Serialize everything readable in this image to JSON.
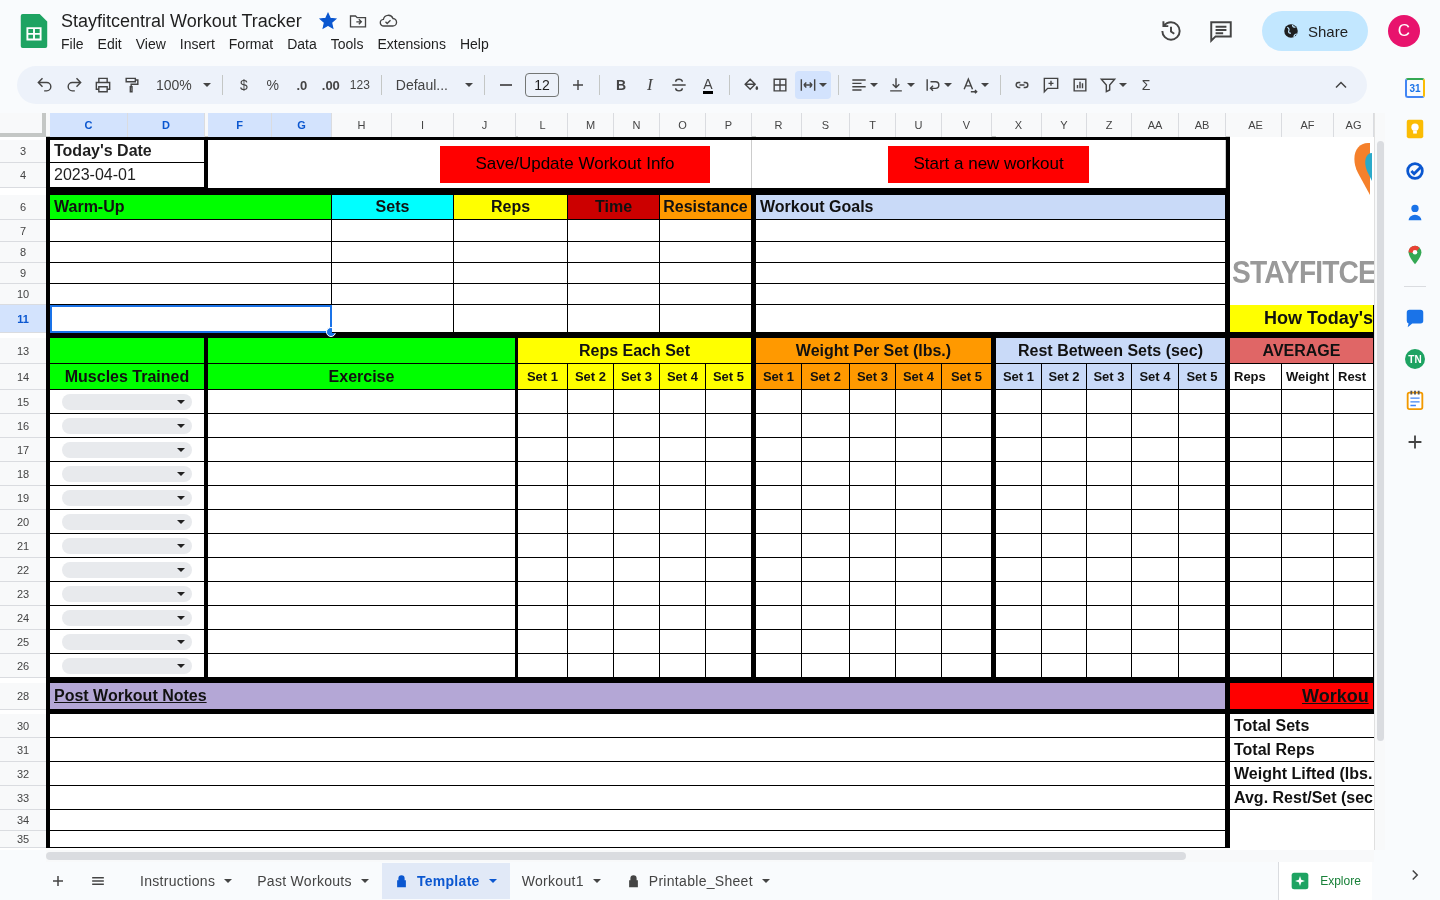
{
  "document": {
    "title": "Stayfitcentral Workout Tracker",
    "starred": true
  },
  "menu": [
    "File",
    "Edit",
    "View",
    "Insert",
    "Format",
    "Data",
    "Tools",
    "Extensions",
    "Help"
  ],
  "account": {
    "share": "Share",
    "avatar": "C"
  },
  "toolbar": [
    {
      "kind": "undo",
      "active": false
    },
    {
      "kind": "redo",
      "active": false
    },
    {
      "kind": "print",
      "active": false
    },
    {
      "kind": "paint",
      "active": false
    },
    {
      "kind": "zoom",
      "label": "100%",
      "active": false
    },
    {
      "kind": "sep"
    },
    {
      "kind": "text",
      "label": "$",
      "active": false
    },
    {
      "kind": "text",
      "label": "%",
      "active": false
    },
    {
      "kind": "decrease",
      "label": ".0",
      "active": false
    },
    {
      "kind": "increase",
      "label": ".00",
      "active": false
    },
    {
      "kind": "small",
      "label": "123",
      "active": false
    },
    {
      "kind": "sep"
    },
    {
      "kind": "font",
      "label": "Defaul...",
      "active": false
    },
    {
      "kind": "sep"
    },
    {
      "kind": "minus",
      "active": false
    },
    {
      "kind": "size",
      "label": "12"
    },
    {
      "kind": "plus",
      "active": false
    },
    {
      "kind": "sep"
    },
    {
      "kind": "bold",
      "label": "B",
      "active": false
    },
    {
      "kind": "italic",
      "label": "I",
      "active": false
    },
    {
      "kind": "strike",
      "active": false
    },
    {
      "kind": "textcolor",
      "label": "A",
      "active": false
    },
    {
      "kind": "sep"
    },
    {
      "kind": "fill",
      "active": false
    },
    {
      "kind": "borders",
      "active": false
    },
    {
      "kind": "merge",
      "active": true
    },
    {
      "kind": "sep"
    },
    {
      "kind": "align",
      "active": false
    },
    {
      "kind": "valign",
      "active": false
    },
    {
      "kind": "wrap",
      "active": false
    },
    {
      "kind": "rotate",
      "active": false
    },
    {
      "kind": "sep"
    },
    {
      "kind": "link",
      "active": false
    },
    {
      "kind": "comment",
      "active": false
    },
    {
      "kind": "chart",
      "active": false
    },
    {
      "kind": "filter",
      "active": false
    },
    {
      "kind": "text",
      "label": "Σ",
      "active": false
    }
  ],
  "columns": [
    {
      "label": "C",
      "selected": true
    },
    {
      "label": "D",
      "selected": true
    },
    {
      "label": "F",
      "selected": true
    },
    {
      "label": "G",
      "selected": true
    },
    {
      "label": "H",
      "selected": false
    },
    {
      "label": "I",
      "selected": false
    },
    {
      "label": "J",
      "selected": false
    },
    {
      "label": "L",
      "selected": false
    },
    {
      "label": "M",
      "selected": false
    },
    {
      "label": "N",
      "selected": false
    },
    {
      "label": "O",
      "selected": false
    },
    {
      "label": "P",
      "selected": false
    },
    {
      "label": "R",
      "selected": false
    },
    {
      "label": "S",
      "selected": false
    },
    {
      "label": "T",
      "selected": false
    },
    {
      "label": "U",
      "selected": false
    },
    {
      "label": "V",
      "selected": false
    },
    {
      "label": "X",
      "selected": false
    },
    {
      "label": "Y",
      "selected": false
    },
    {
      "label": "Z",
      "selected": false
    },
    {
      "label": "AA",
      "selected": false
    },
    {
      "label": "AB",
      "selected": false
    },
    {
      "label": "AE",
      "selected": false
    },
    {
      "label": "AF",
      "selected": false
    },
    {
      "label": "AG",
      "selected": false
    }
  ],
  "rows": [
    {
      "label": "3",
      "selected": false
    },
    {
      "label": "4",
      "selected": false
    },
    {
      "label": "6",
      "selected": false
    },
    {
      "label": "7",
      "selected": false
    },
    {
      "label": "8",
      "selected": false
    },
    {
      "label": "9",
      "selected": false
    },
    {
      "label": "10",
      "selected": false
    },
    {
      "label": "11",
      "selected": true
    },
    {
      "label": "13",
      "selected": false
    },
    {
      "label": "14",
      "selected": false
    },
    {
      "label": "15",
      "selected": false
    },
    {
      "label": "16",
      "selected": false
    },
    {
      "label": "17",
      "selected": false
    },
    {
      "label": "18",
      "selected": false
    },
    {
      "label": "19",
      "selected": false
    },
    {
      "label": "20",
      "selected": false
    },
    {
      "label": "21",
      "selected": false
    },
    {
      "label": "22",
      "selected": false
    },
    {
      "label": "23",
      "selected": false
    },
    {
      "label": "24",
      "selected": false
    },
    {
      "label": "25",
      "selected": false
    },
    {
      "label": "26",
      "selected": false
    },
    {
      "label": "28",
      "selected": false
    },
    {
      "label": "30",
      "selected": false
    },
    {
      "label": "31",
      "selected": false
    },
    {
      "label": "32",
      "selected": false
    },
    {
      "label": "33",
      "selected": false
    },
    {
      "label": "34",
      "selected": false
    },
    {
      "label": "35",
      "selected": false
    }
  ],
  "date_block": {
    "label": "Today's Date",
    "value": "2023-04-01"
  },
  "actions": [
    "Save/Update Workout Info",
    "Start a new workout"
  ],
  "warmup": {
    "headers": [
      {
        "label": "Warm-Up",
        "color": "#00ff00"
      },
      {
        "label": "Sets",
        "color": "#00ffff"
      },
      {
        "label": "Reps",
        "color": "#ffff00"
      },
      {
        "label": "Time",
        "color": "#cc0000"
      },
      {
        "label": "Resistance",
        "color": "#ff9900"
      }
    ],
    "rows": [
      {
        "selected": false
      },
      {
        "selected": false
      },
      {
        "selected": false
      },
      {
        "selected": false
      },
      {
        "selected": true
      }
    ]
  },
  "goals": {
    "title": "Workout Goals"
  },
  "logo": "**STAY**FIT**CE**",
  "today_heading": "How Today's",
  "exercise_table": {
    "muscles_heading": "Muscles Trained",
    "exercise_heading": "Exercise",
    "groups": [
      {
        "label": "Reps Each Set",
        "color": "#ffff00",
        "sets": [
          "Set 1",
          "Set 2",
          "Set 3",
          "Set 4",
          "Set 5"
        ]
      },
      {
        "label": "Weight Per Set (lbs.)",
        "color": "#ff9900",
        "sets": [
          "Set 1",
          "Set 2",
          "Set 3",
          "Set 4",
          "Set 5"
        ]
      },
      {
        "label": "Rest Between Sets (sec)",
        "color": "#c9daf8",
        "sets": [
          "Set 1",
          "Set 2",
          "Set 3",
          "Set 4",
          "Set 5"
        ]
      }
    ],
    "average": {
      "label": "AVERAGE",
      "color": "#e06666",
      "columns": [
        "Reps",
        "Weight",
        "Rest"
      ]
    }
  },
  "notes": {
    "title": "Post Workout Notes"
  },
  "summary": {
    "title": "Workou",
    "labels": [
      "Total Sets",
      "Total Reps",
      "Weight Lifted (lbs.",
      "Avg. Rest/Set (sec"
    ]
  },
  "sheet_tabs": [
    {
      "label": "Instructions",
      "selected": false,
      "locked": false
    },
    {
      "label": "Past Workouts",
      "selected": false,
      "locked": false
    },
    {
      "label": "Template",
      "selected": true,
      "locked": true
    },
    {
      "label": "Workout1",
      "selected": false,
      "locked": false
    },
    {
      "label": "Printable_Sheet",
      "selected": false,
      "locked": true
    }
  ],
  "explore": "Explore",
  "side_panel": [
    {
      "kind": "calendar",
      "label": "31"
    },
    {
      "kind": "keep"
    },
    {
      "kind": "tasks"
    },
    {
      "kind": "contacts"
    },
    {
      "kind": "maps"
    },
    {
      "kind": "chat"
    },
    {
      "kind": "badge",
      "label": "TN"
    },
    {
      "kind": "notepad"
    },
    {
      "kind": "add"
    }
  ]
}
